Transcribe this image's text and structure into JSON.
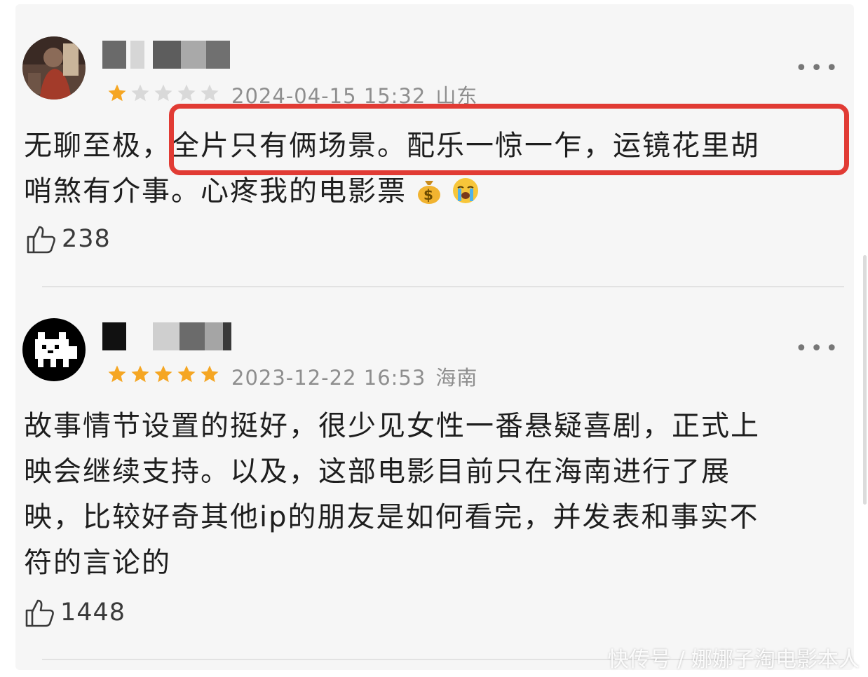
{
  "reviews": [
    {
      "username": "",
      "rating": 1,
      "max_rating": 5,
      "date": "2024-04-15 15:32",
      "location": "山东",
      "text_lines": [
        "无聊至极，全片只有俩场景。配乐一惊一乍，运镜花里胡",
        "哨煞有介事。心疼我的电影票"
      ],
      "emojis": [
        "money-bag-emoji",
        "crying-face-emoji"
      ],
      "likes": "238",
      "highlighted_text": "全片只有俩场景。配乐一惊一乍，运镜花里胡"
    },
    {
      "username": "",
      "rating": 5,
      "max_rating": 5,
      "date": "2023-12-22 16:53",
      "location": "海南",
      "text_lines": [
        "故事情节设置的挺好，很少见女性一番悬疑喜剧，正式上",
        "映会继续支持。以及，这部电影目前只在海南进行了展",
        "映，比较好奇其他ip的朋友是如何看完，并发表和事实不",
        "符的言论的"
      ],
      "likes": "1448"
    }
  ],
  "more_label": "•••",
  "watermark": "快传号 / 娜娜子淘电影本人",
  "colors": {
    "star_filled": "#f5a623",
    "star_empty": "#d9d9d9",
    "highlight_border": "#e13b34",
    "meta_text": "#8e8e8e",
    "background": "#f6f6f6"
  },
  "icons": [
    "thumbs-up-icon",
    "more-icon",
    "star-icon"
  ]
}
